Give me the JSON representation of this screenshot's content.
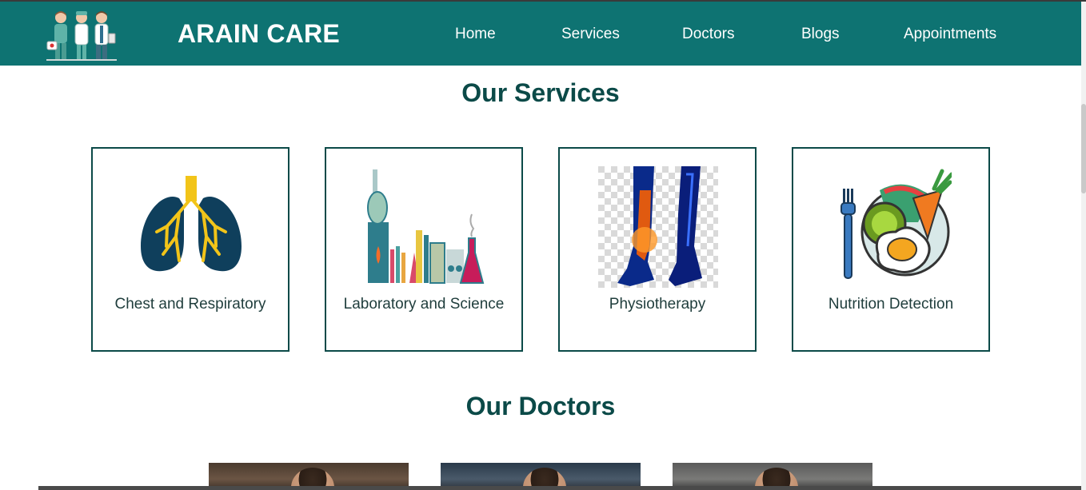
{
  "header": {
    "brand": "ARAIN CARE",
    "logo_icon": "doctors-team-logo",
    "nav": [
      {
        "label": "Home"
      },
      {
        "label": "Services"
      },
      {
        "label": "Doctors"
      },
      {
        "label": "Blogs"
      },
      {
        "label": "Appointments"
      }
    ]
  },
  "services": {
    "title": "Our Services",
    "items": [
      {
        "label": "Chest and Respiratory",
        "icon": "lungs-icon"
      },
      {
        "label": "Laboratory and Science",
        "icon": "lab-equipment-icon"
      },
      {
        "label": "Physiotherapy",
        "icon": "leg-joint-icon"
      },
      {
        "label": "Nutrition Detection",
        "icon": "food-plate-icon"
      }
    ]
  },
  "doctors": {
    "title": "Our Doctors",
    "photos": [
      "doctor-photo",
      "doctor-photo",
      "doctor-photo"
    ]
  },
  "colors": {
    "navbar": "#0e7372",
    "heading": "#0b4a48",
    "card_border": "#0b4a48",
    "nav_text": "#ffffff"
  }
}
